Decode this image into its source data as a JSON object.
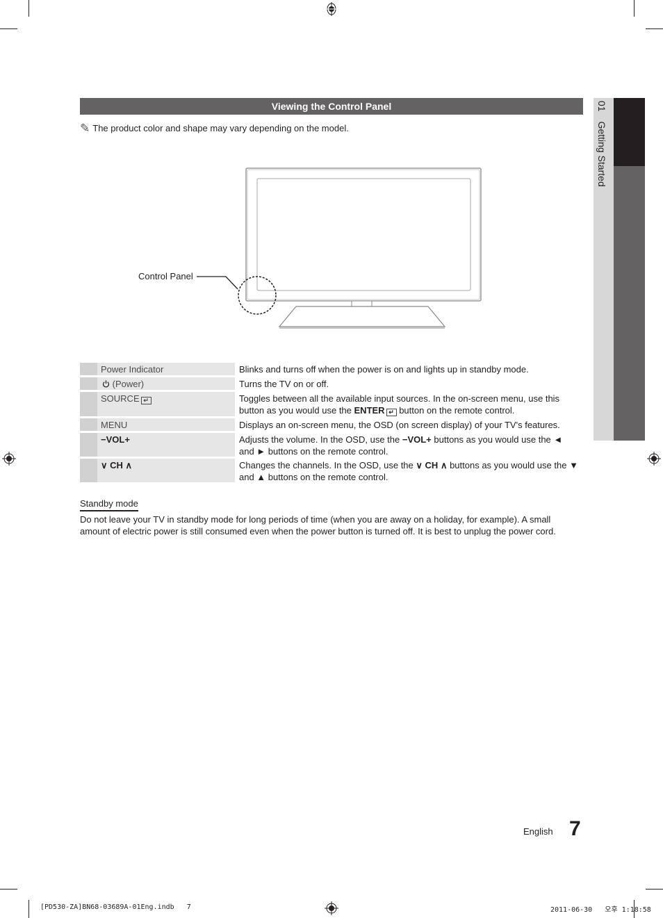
{
  "section": {
    "title": "Viewing the Control Panel",
    "note_icon": "pencil-note-icon",
    "note": "The product color and shape may vary depending on the model."
  },
  "diagram": {
    "callout_label": "Control Panel"
  },
  "controls": [
    {
      "name": "Power Indicator",
      "description": "Blinks and turns off when the power is on and lights up in standby mode."
    },
    {
      "name_icon": "power-icon",
      "name": "(Power)",
      "description": "Turns the TV on or off."
    },
    {
      "name": "SOURCE",
      "name_icon": "enter-icon",
      "description_part1": "Toggles between all the available input sources. In the on-screen menu, use this button as you would use the ",
      "description_bold": "ENTER",
      "description_part2": " button on the remote control."
    },
    {
      "name": "MENU",
      "description": "Displays an on-screen menu, the OSD (on screen display) of your TV's features."
    },
    {
      "name": "−VOL+",
      "description_part1": "Adjusts the volume. In the OSD, use the ",
      "description_bold": "−VOL+",
      "description_part2": " buttons as you would use the ◄ and ► buttons on the remote control."
    },
    {
      "name_prefix": "∨",
      "name": "CH",
      "name_suffix": "∧",
      "description_part1": "Changes the channels. In the OSD, use the ",
      "description_bold_prefix": "∨",
      "description_bold": "CH",
      "description_bold_suffix": "∧",
      "description_part2": " buttons as you would use the ▼ and ▲ buttons on the remote control."
    }
  ],
  "standby": {
    "title": "Standby mode",
    "text": "Do not leave your TV in standby mode for long periods of time (when you are away on a holiday, for example). A small amount of electric power is still consumed even when the power button is turned off. It is best to unplug the power cord."
  },
  "side_tab": {
    "chapter_number": "01",
    "chapter_title": "Getting Started"
  },
  "footer": {
    "language": "English",
    "page_number": "7",
    "slug_file": "[PD530-ZA]BN68-03689A-01Eng.indb   7",
    "slug_timestamp": "2011-06-30   오후 1:18:58"
  },
  "colors": {
    "header_bg": "#656263",
    "tab_dark": "#231f20",
    "tab_mid": "#656263",
    "tab_light": "#d8d7d7",
    "row_num_bg": "#d2d1d1",
    "row_name_bg": "#e7e6e6"
  }
}
